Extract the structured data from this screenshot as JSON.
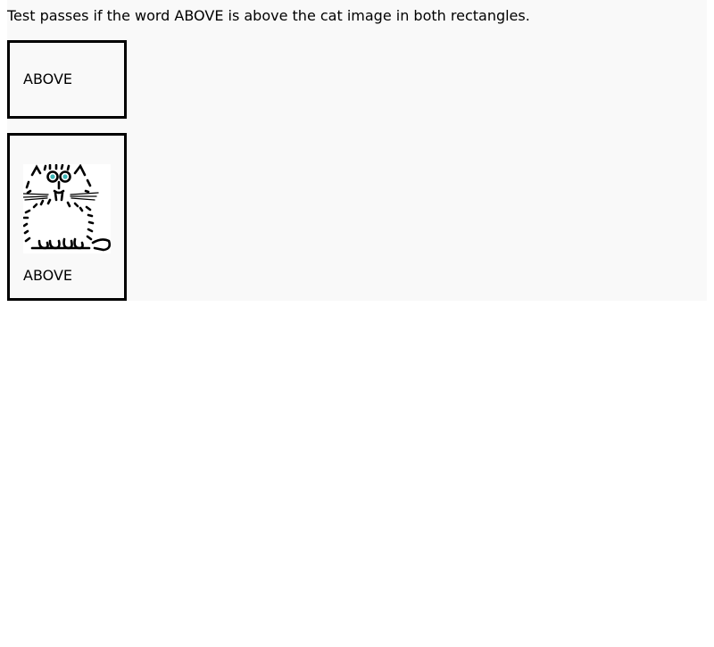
{
  "instruction": "Test passes if the word ABOVE is above the cat image in both rectangles.",
  "rect1": {
    "label": "ABOVE"
  },
  "rect2": {
    "label": "ABOVE",
    "image": {
      "icon": "cat-icon"
    }
  },
  "colors": {
    "page_bg": "#f9f9f9",
    "border": "#000000",
    "cat_eyes": "#3fb6b6"
  }
}
